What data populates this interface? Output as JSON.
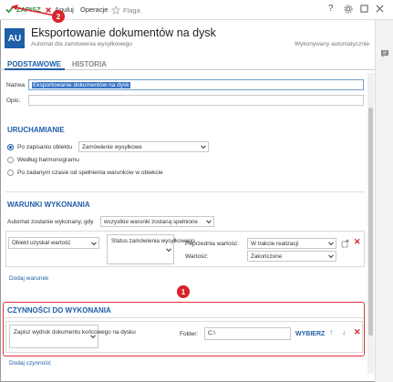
{
  "toolbar": {
    "save_label": "ZAPISZ",
    "cancel_label": "Anuluj",
    "operations_label": "Operacje",
    "flag_label": "Flaga",
    "help_label": "?"
  },
  "header": {
    "avatar_initials": "AU",
    "title": "Eksportowanie dokumentów na dysk",
    "subtitle": "Automat dla zamówienia wysyłkowego",
    "auto_label": "Wykonywany automatycznie"
  },
  "tabs": [
    {
      "label": "PODSTAWOWE",
      "active": true
    },
    {
      "label": "HISTORIA",
      "active": false
    }
  ],
  "form": {
    "name_label": "Nazwa:",
    "name_value": "Eksportowanie dokumentów na dysk",
    "desc_label": "Opis:",
    "desc_value": ""
  },
  "uruchamianie": {
    "title": "URUCHAMIANIE",
    "options": [
      {
        "label": "Po zapisaniu obiektu",
        "selected": true
      },
      {
        "label": "Według harmonogramu",
        "selected": false
      },
      {
        "label": "Po zadanym czasie od spełnienia warunków w obiekcie",
        "selected": false
      }
    ],
    "object_select": "Zamówienie wysyłkowe"
  },
  "warunki": {
    "title": "WARUNKI WYKONANIA",
    "mode_label": "Automat zostanie wykonany, gdy",
    "mode_value": "wszystkie warunki zostaną spełnione",
    "condition": {
      "type": "Obiekt uzyskał wartość",
      "field": "Status zamówienia wysyłkowego",
      "prev_label": "Poprzednia wartość:",
      "prev_value": "W trakcie realizacji",
      "value_label": "Wartość:",
      "value_value": "Zakończone"
    },
    "add_link": "Dodaj warunek"
  },
  "czynnosci": {
    "title": "CZYNNOŚCI DO WYKONANIA",
    "action_value": "Zapisz wydruk dokumentu końcowego na dysku",
    "folder_label": "Folder:",
    "folder_value": "C:\\",
    "choose_label": "WYBIERZ",
    "add_link": "Dodaj czynność"
  },
  "badges": {
    "badge1": "1",
    "badge2": "2"
  },
  "colors": {
    "accent": "#1f5ea8",
    "save_green": "#2e8b3e",
    "danger_red": "#d42323",
    "highlight_red": "#e0323a"
  }
}
